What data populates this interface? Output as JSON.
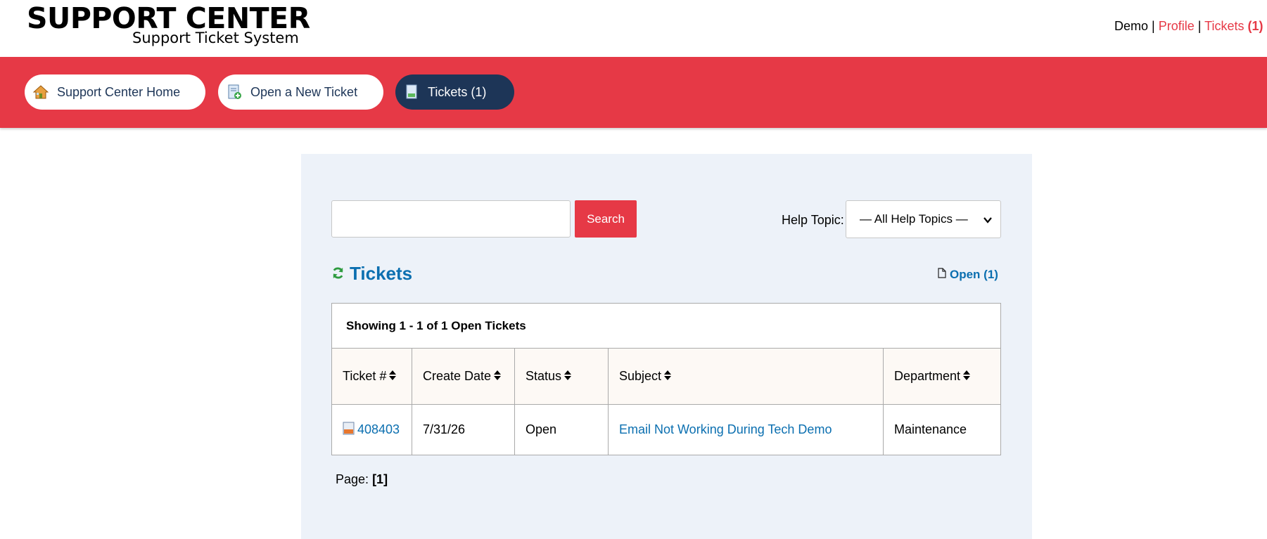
{
  "header": {
    "logo_title": "SUPPORT CENTER",
    "logo_subtitle": "Support Ticket System",
    "user_name": "Demo",
    "separator": "|",
    "profile_label": "Profile",
    "tickets_label": "Tickets",
    "tickets_count": "(1)",
    "trailing": "-"
  },
  "nav": {
    "items": [
      {
        "label": "Support Center Home",
        "icon": "home-icon"
      },
      {
        "label": "Open a New Ticket",
        "icon": "new-ticket-icon"
      },
      {
        "label": "Tickets (1)",
        "icon": "tickets-icon",
        "active": true
      }
    ]
  },
  "search": {
    "value": "",
    "button_label": "Search",
    "help_topic_label": "Help Topic:",
    "help_topic_selected": "— All Help Topics —"
  },
  "tickets": {
    "heading": "Tickets",
    "open_link": "Open (1)",
    "caption": "Showing 1 - 1 of 1 Open Tickets",
    "columns": [
      "Ticket #",
      "Create Date",
      "Status",
      "Subject",
      "Department"
    ],
    "rows": [
      {
        "number": "408403",
        "date": "7/31/26",
        "status": "Open",
        "subject": "Email Not Working During Tech Demo",
        "department": "Maintenance"
      }
    ],
    "page_label": "Page:",
    "page_current": "[1]"
  },
  "colors": {
    "brand_red": "#e63946",
    "navy": "#1d3557",
    "link_blue": "#0b6fb0",
    "panel_bg": "#edf2f9"
  }
}
